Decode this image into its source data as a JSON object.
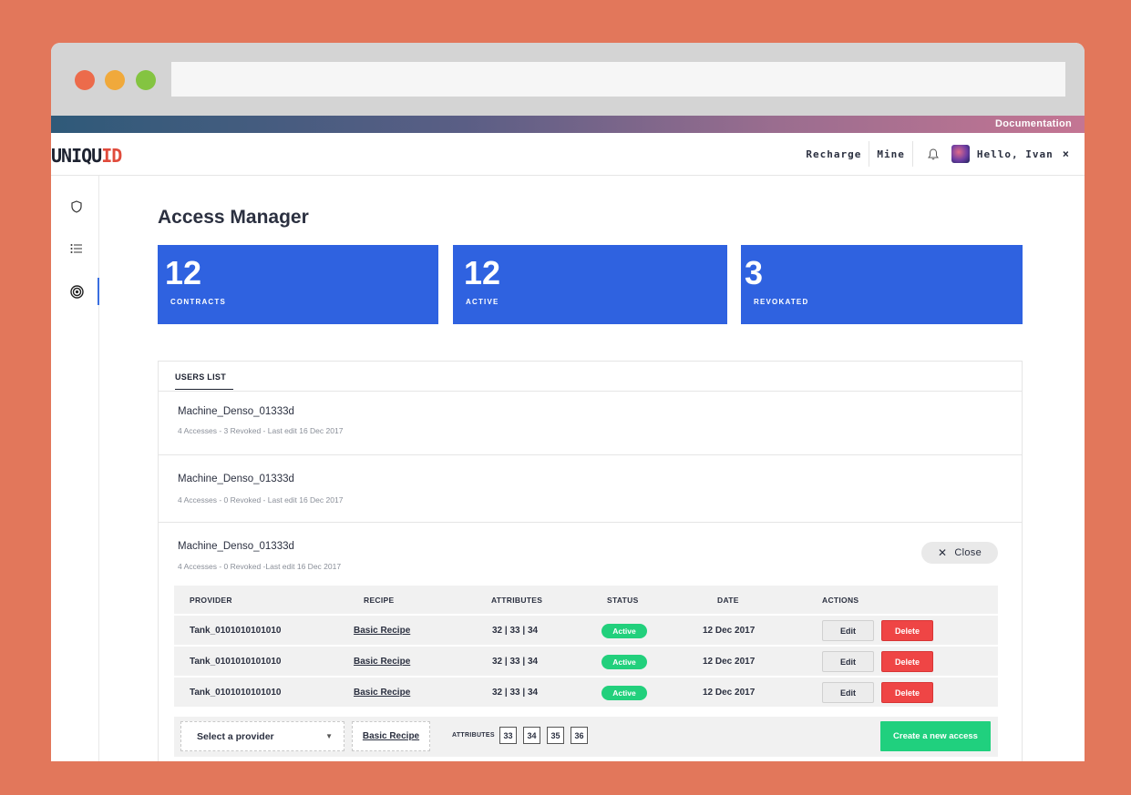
{
  "browser": {
    "url": ""
  },
  "banner": {
    "documentation": "Documentation"
  },
  "header": {
    "logo_main": "UNIQU",
    "logo_accent": "ID",
    "nav": {
      "recharge": "Recharge",
      "mine": "Mine",
      "greeting": "Hello, Ivan",
      "close": "×"
    }
  },
  "sidebar": {
    "icons": [
      "shield-icon",
      "list-icon",
      "target-icon"
    ],
    "active_index": 2
  },
  "page": {
    "title": "Access Manager"
  },
  "stats": [
    {
      "value": "12",
      "label": "CONTRACTS"
    },
    {
      "value": "12",
      "label": "ACTIVE"
    },
    {
      "value": "3",
      "label": "REVOKATED"
    }
  ],
  "users_list": {
    "tab_label": "USERS LIST",
    "users": [
      {
        "name": "Machine_Denso_01333d",
        "meta": "4 Accesses - 3 Revoked - Last edit 16 Dec 2017"
      },
      {
        "name": "Machine_Denso_01333d",
        "meta": "4 Accesses - 0 Revoked - Last edit 16 Dec 2017"
      },
      {
        "name": "Machine_Denso_01333d",
        "meta": "4 Accesses - 0 Revoked -Last edit 16 Dec 2017"
      }
    ],
    "close_label": "Close",
    "table": {
      "headers": [
        "PROVIDER",
        "RECIPE",
        "ATTRIBUTES",
        "STATUS",
        "DATE",
        "ACTIONS"
      ],
      "rows": [
        {
          "provider": "Tank_0101010101010",
          "recipe": "Basic Recipe",
          "attributes": "32 | 33 | 34",
          "status": "Active",
          "date": "12 Dec 2017",
          "edit": "Edit",
          "delete": "Delete"
        },
        {
          "provider": "Tank_0101010101010",
          "recipe": "Basic Recipe",
          "attributes": "32 | 33 | 34",
          "status": "Active",
          "date": "12 Dec 2017",
          "edit": "Edit",
          "delete": "Delete"
        },
        {
          "provider": "Tank_0101010101010",
          "recipe": "Basic Recipe",
          "attributes": "32 | 33 | 34",
          "status": "Active",
          "date": "12 Dec 2017",
          "edit": "Edit",
          "delete": "Delete"
        }
      ]
    },
    "create": {
      "provider_placeholder": "Select a provider",
      "recipe": "Basic Recipe",
      "attributes_label": "ATTRIBUTES",
      "attributes": [
        "33",
        "34",
        "35",
        "36"
      ],
      "button": "Create a new access"
    }
  },
  "colors": {
    "accent_blue": "#2f62e0",
    "active_green": "#22d07c",
    "delete_red": "#ef4545",
    "create_green": "#20d07e",
    "background": "#e2775b"
  }
}
